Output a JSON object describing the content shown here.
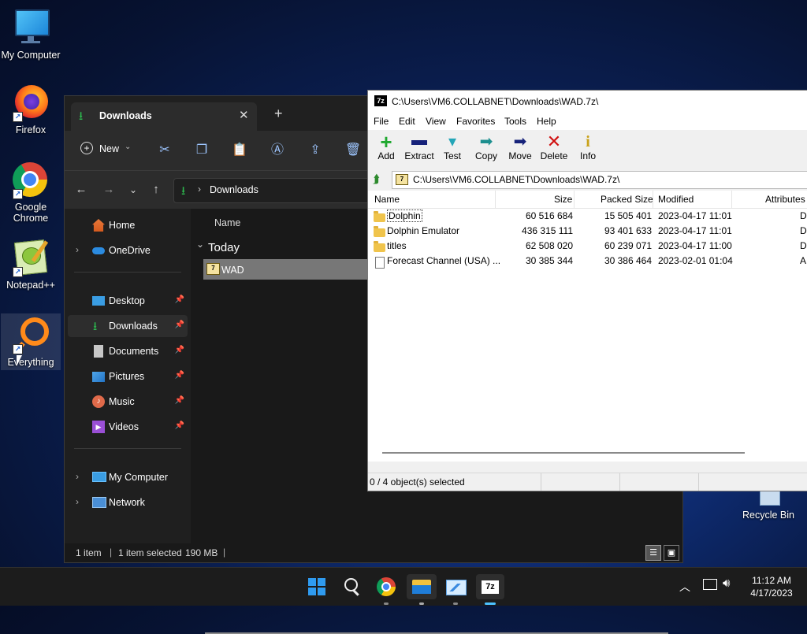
{
  "desktop": {
    "icons": [
      {
        "label": "My Computer"
      },
      {
        "label": "Firefox"
      },
      {
        "label": "Google Chrome"
      },
      {
        "label": "Notepad++"
      },
      {
        "label": "Everything"
      }
    ],
    "recycle_bin": "Recycle Bin"
  },
  "explorer": {
    "tab_title": "Downloads",
    "new_label": "New",
    "address": "Downloads",
    "column_name": "Name",
    "group": "Today",
    "file": "WAD",
    "sidebar": {
      "home": "Home",
      "onedrive": "OneDrive",
      "desktop": "Desktop",
      "downloads": "Downloads",
      "documents": "Documents",
      "pictures": "Pictures",
      "music": "Music",
      "videos": "Videos",
      "my_computer": "My Computer",
      "network": "Network"
    },
    "status": {
      "count": "1 item",
      "selected": "1 item selected",
      "size": "190 MB"
    }
  },
  "zip": {
    "title": "C:\\Users\\VM6.COLLABNET\\Downloads\\WAD.7z\\",
    "menu": [
      "File",
      "Edit",
      "View",
      "Favorites",
      "Tools",
      "Help"
    ],
    "toolbar": [
      "Add",
      "Extract",
      "Test",
      "Copy",
      "Move",
      "Delete",
      "Info"
    ],
    "path": "C:\\Users\\VM6.COLLABNET\\Downloads\\WAD.7z\\",
    "columns": [
      "Name",
      "Size",
      "Packed Size",
      "Modified",
      "Attributes"
    ],
    "rows": [
      {
        "name": "Dolphin",
        "size": "60 516 684",
        "packed": "15 505 401",
        "modified": "2023-04-17 11:01",
        "attr": "D",
        "type": "folder"
      },
      {
        "name": "Dolphin Emulator",
        "size": "436 315 111",
        "packed": "93 401 633",
        "modified": "2023-04-17 11:01",
        "attr": "D",
        "type": "folder"
      },
      {
        "name": "titles",
        "size": "62 508 020",
        "packed": "60 239 071",
        "modified": "2023-04-17 11:00",
        "attr": "D",
        "type": "folder"
      },
      {
        "name": "Forecast Channel (USA) ...",
        "size": "30 385 344",
        "packed": "30 386 464",
        "modified": "2023-02-01 01:04",
        "attr": "A",
        "type": "file"
      }
    ],
    "status": "0 / 4 object(s) selected"
  },
  "taskbar": {
    "time": "11:12 AM",
    "date": "4/17/2023"
  },
  "colors": {
    "accent_green": "#2db84e",
    "zip_add": "#1fa82f",
    "zip_delete": "#d01010",
    "zip_move": "#16227a"
  }
}
